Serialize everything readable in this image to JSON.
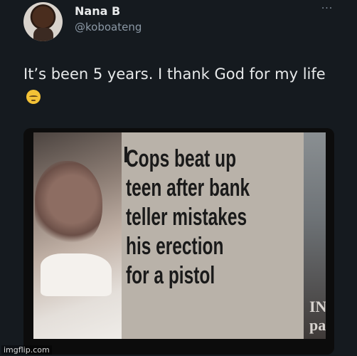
{
  "author": {
    "name": "Nana B",
    "handle": "@koboateng"
  },
  "menu": {
    "more_label": "···"
  },
  "tweet": {
    "text": "It’s been 5 years. I thank God for my life",
    "emoji_name": "pensive-face-icon"
  },
  "media": {
    "headline_lines": [
      "Cops beat up",
      "teen after bank",
      "teller mistakes",
      "his erection",
      "for a pistol"
    ],
    "side_page_text": [
      "IN",
      "pa"
    ]
  },
  "watermark": {
    "text": "imgflip.com"
  },
  "colors": {
    "background": "#151a1f",
    "text_primary": "#e7e9ea",
    "text_secondary": "#8b98a5"
  }
}
